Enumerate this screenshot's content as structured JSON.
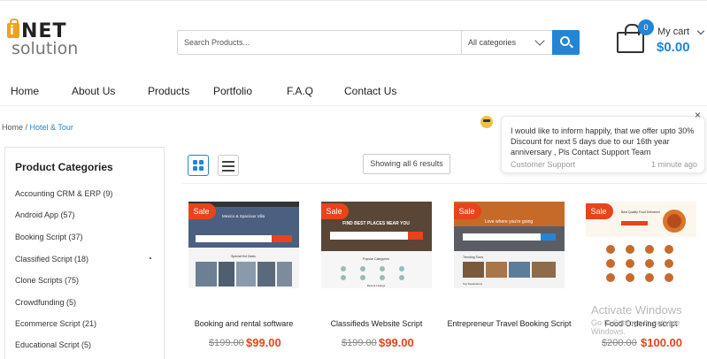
{
  "brand": {
    "logo_top": "NET",
    "logo_bottom": "solution",
    "logo_i": "i"
  },
  "search": {
    "placeholder": "Search Products...",
    "category": "All categories"
  },
  "cart": {
    "count": "0",
    "label": "My cart",
    "total": "$0.00"
  },
  "nav": [
    "Home",
    "About Us",
    "Products",
    "Portfolio",
    "F.A.Q",
    "Contact Us"
  ],
  "breadcrumb": {
    "home": "Home",
    "sep": " / ",
    "current": "Hotel & Tour"
  },
  "sidebar": {
    "title": "Product Categories",
    "items": [
      "Accounting CRM & ERP (9)",
      "Android App (57)",
      "Booking Script (37)",
      "Classified Script (18)",
      "Clone Scripts (75)",
      "Crowdfunding (5)",
      "Ecommerce Script (21)",
      "Educational Script (5)"
    ]
  },
  "toolbar": {
    "results": "Showing all 6 results"
  },
  "products": [
    {
      "badge": "Sale",
      "name": "Booking and rental software",
      "old_price": "$199.00",
      "new_price": "$99.00"
    },
    {
      "badge": "Sale",
      "name": "Classifieds Website Script",
      "old_price": "$199.00",
      "new_price": "$99.00"
    },
    {
      "badge": "Sale",
      "name": "Entrepreneur Travel Booking Script",
      "old_price": "",
      "new_price": ""
    },
    {
      "badge": "Sale",
      "name": "Food Ordering script",
      "old_price": "$200.00",
      "new_price": "$100.00"
    }
  ],
  "thumbs": [
    {
      "hero_text": "Mexico & Spacious Villa",
      "section_text": "Special Hot Deals"
    },
    {
      "hero_text": "FIND BEST PLACES NEAR YOU",
      "section_text": "Popular Categories",
      "footer_text": "Recent Listings"
    },
    {
      "hero_text": "Love where you're going",
      "section_text": "Trending Tours",
      "footer_text": "Top Destinations"
    },
    {
      "hero_text": "Best Quality Food Delivered"
    }
  ],
  "chat": {
    "close": "×",
    "message": "I would like to inform happily, that we offer upto 30% Discount for next 5 days due to our 16th year anniversary , Pls Contact Support  Team",
    "sender": "Customer Support",
    "time": "1 minute ago"
  },
  "watermark": {
    "line1": "Activate Windows",
    "line2": "Go to Settings to activate Windows."
  },
  "colors": {
    "accent": "#2285d6",
    "sale": "#e8431b"
  }
}
